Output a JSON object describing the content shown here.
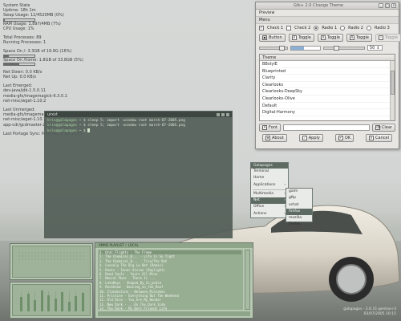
{
  "conky": {
    "lines": [
      "System State",
      "Uptime: 18h 1m",
      "Swap Usage: 11/4520MB (0%)",
      "RAM Usage: 1,897/4MB (7%)",
      "CPU Usage: 1%",
      "",
      "Total Processes: 89",
      "Running Processes: 1",
      "",
      "Space On /: 3.3GB of 19.9G (16%)",
      "Space On /home: 1.8GB of 33.8GB (5%)",
      "",
      "Net Down: 0.0 KB/s",
      "Net Up: 0.0 KB/s",
      "",
      "Last Emerged:",
      "dev-java/jdk-1.5.0.11",
      "media-gfx/imagemagick-6.3.0.1",
      "net-misc/wget-1.10.2",
      "",
      "Last Unmerged:",
      "media-gfx/imagemagick-6.1.8.8",
      "net-misc/wget-1.10.1",
      "app-cdr/gcdmaster-2.0.0",
      "",
      "Last Portage Sync: Mon Mar 7 10:30:01"
    ],
    "swap_usage": 0.02,
    "space_root": 0.16,
    "space_home": 0.5
  },
  "gtk_window": {
    "title": "Gtk+ 2.0 Change Theme",
    "tab": "Preview",
    "menu": "Menu",
    "check1": "Check 1",
    "check2": "Check 2",
    "radio1": "Radio 1",
    "radio2": "Radio 2",
    "radio3": "Radio 3",
    "button": "Button",
    "toggle1": "Toggle",
    "toggle2": "Toggle",
    "toggle3": "Toggle",
    "toggle4": "Toggle",
    "progress": 0.45,
    "spin_value": "50",
    "list_header": "Theme",
    "themes": [
      "BBstylE",
      "Blueprinted",
      "Clarity",
      "Clearlooks",
      "Clearlooks-DeepSky",
      "Clearlooks-Olive",
      "Default",
      "Digital-Harmony"
    ],
    "font_button": "Font",
    "clear_button": "Clear",
    "about_button": "About",
    "apply_button": "Apply",
    "ok_button": "OK",
    "cancel_button": "Cancel"
  },
  "terminal": {
    "title": "urxvt",
    "lines": [
      {
        "prompt": "kris@galapagos",
        "cmd": "~ $ sleep 5; import -window root march-07-2005.png"
      },
      {
        "prompt": "kris@galapagos",
        "cmd": "~ $ sleep 5; import -window root march-07-2005.png"
      },
      {
        "prompt": "kris@galapagos",
        "cmd": "~ $ "
      }
    ]
  },
  "root_menu": {
    "title": "Galapagos",
    "items": [
      "Terminal",
      "Home",
      "Applications",
      "Multimedia",
      "Net",
      "Office",
      "Actions"
    ],
    "selected": "Net",
    "submenu": [
      "gaim",
      "gftp",
      "xchat",
      "firefox",
      "mozilla firefox"
    ],
    "submenu_selected": "firefox"
  },
  "playlist": {
    "title": "XMMS PLAYLIST  ::  LOCAL",
    "items": [
      "1. Oral Flights - The Frame",
      "2. The Chemical_B... - Life Is So Tight",
      "3. The Chemical_B... - Trio/The Rat",
      "4. Loosely The Big Lw Bet (Remix)",
      "5. Roots - Inner Vision (Daylight)",
      "6. Dead Souls - Yours All Mine",
      "7. Neural Muse - There Is ...",
      "8. LateBoys - Shaped_By_In_pedia",
      "9. Rockhead - Dancing_on_the_Roof",
      "10. Clandestine - Between_Mistakes",
      "11. Pristine - Everything But The Weekend",
      "12. Old Rise - You_Are_My_Wonder",
      "13. New Dark - ...On_The_Dark_Side",
      "14. The Dark - My Best Friends Life"
    ],
    "current_index": 0
  },
  "corner": {
    "host": "galapagos - 2.6.11-gentoo-r3",
    "date": "03/07/2005 10:15"
  }
}
